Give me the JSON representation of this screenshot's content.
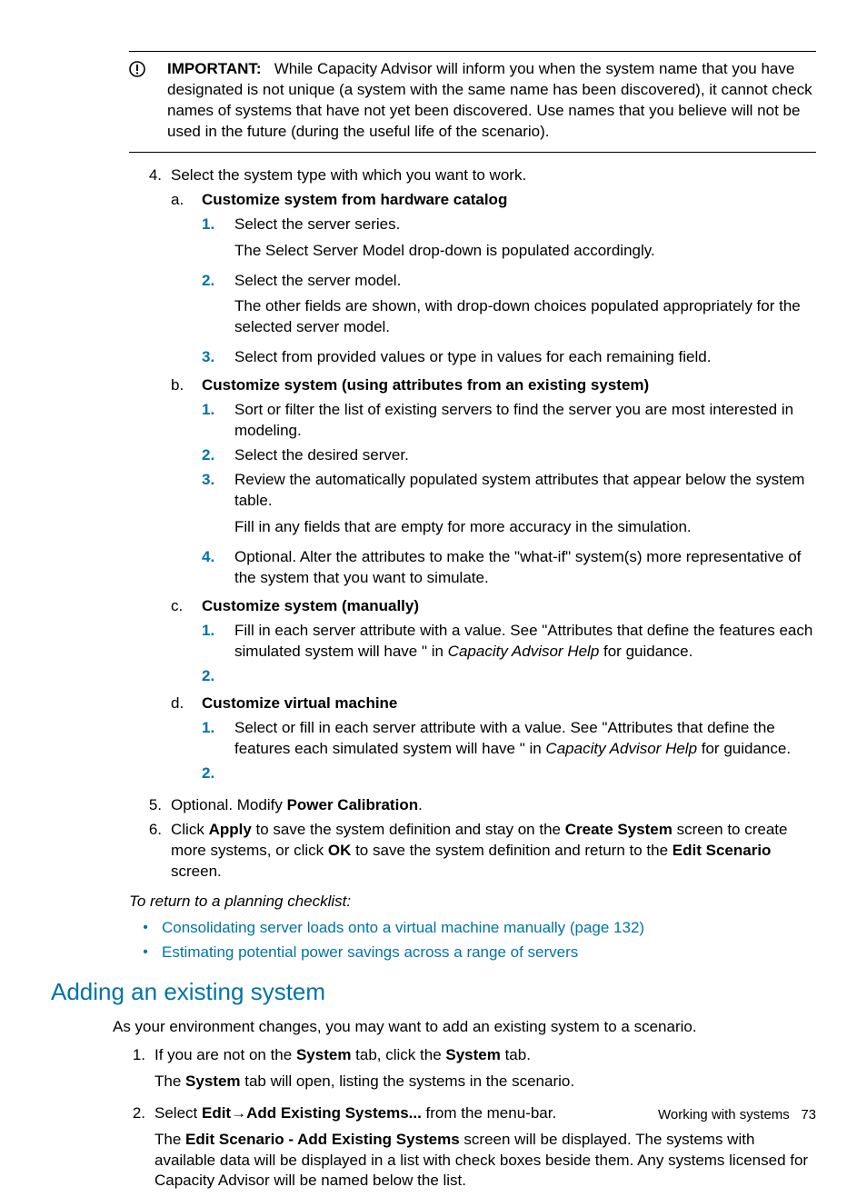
{
  "important": {
    "label": "IMPORTANT:",
    "text": "While Capacity Advisor will inform you when the system name that you have designated is not unique (a system with the same name has been discovered), it cannot check names of systems that have not yet been discovered. Use names that you believe will not be used in the future (during the useful life of the scenario)."
  },
  "step4": {
    "marker": "4.",
    "text": "Select the system type with which you want to work.",
    "a": {
      "marker": "a.",
      "title": "Customize system from hardware catalog",
      "s1": {
        "m": "1.",
        "t1": "Select the server series.",
        "t2": "The Select Server Model drop-down is populated accordingly."
      },
      "s2": {
        "m": "2.",
        "t1": "Select the server model.",
        "t2": "The other fields are shown, with drop-down choices populated appropriately for the selected server model."
      },
      "s3": {
        "m": "3.",
        "t1": "Select from provided values or type in values for each remaining field."
      }
    },
    "b": {
      "marker": "b.",
      "title": "Customize system (using attributes from an existing system)",
      "s1": {
        "m": "1.",
        "t1": "Sort or filter the list of existing servers to find the server you are most interested in modeling."
      },
      "s2": {
        "m": "2.",
        "t1": "Select the desired server."
      },
      "s3": {
        "m": "3.",
        "t1": "Review the automatically populated system attributes that appear below the system table.",
        "t2": "Fill in any fields that are empty for more accuracy in the simulation."
      },
      "s4": {
        "m": "4.",
        "t1": "Optional. Alter the attributes to make the \"what-if\" system(s) more representative of the system that you want to simulate."
      }
    },
    "c": {
      "marker": "c.",
      "title": "Customize system (manually)",
      "s1": {
        "m": "1.",
        "pre": "Fill in each server attribute with a value. See \"Attributes that define the features each simulated system will have \" in ",
        "cite": "Capacity Advisor Help",
        "post": " for guidance."
      },
      "s2": {
        "m": "2."
      }
    },
    "d": {
      "marker": "d.",
      "title": "Customize virtual machine",
      "s1": {
        "m": "1.",
        "pre": "Select or fill in each server attribute with a value. See \"Attributes that define the features each simulated system will have \" in ",
        "cite": "Capacity Advisor Help",
        "post": " for guidance."
      },
      "s2": {
        "m": "2."
      }
    }
  },
  "step5": {
    "marker": "5.",
    "pre": "Optional. Modify ",
    "b": "Power Calibration",
    "post": "."
  },
  "step6": {
    "marker": "6.",
    "p1": "Click ",
    "b1": "Apply",
    "p2": " to save the system definition and stay on the ",
    "b2": "Create System",
    "p3": " screen to create more systems, or click ",
    "b3": "OK",
    "p4": " to save the system definition and return to the ",
    "b4": "Edit Scenario",
    "p5": " screen."
  },
  "checklist": {
    "title": "To return to a planning checklist:",
    "l1": "Consolidating server loads onto a virtual machine manually (page 132)",
    "l2": "Estimating potential power savings across a range of servers"
  },
  "section": {
    "title": "Adding an existing system",
    "intro": "As your environment changes, you may want to add an existing system to a scenario.",
    "s1": {
      "m": "1.",
      "p1": "If you are not on the ",
      "b1": "System",
      "p2": " tab, click the ",
      "b2": "System",
      "p3": " tab.",
      "follow_pre": "The ",
      "follow_b": "System",
      "follow_post": " tab will open, listing the systems in the scenario."
    },
    "s2": {
      "m": "2.",
      "p1": "Select ",
      "b1": "Edit",
      "arrow": "→",
      "b2": "Add Existing Systems...",
      "p2": " from the menu-bar.",
      "follow_pre": "The ",
      "follow_b": "Edit Scenario - Add Existing Systems",
      "follow_post": " screen will be displayed. The systems with available data will be displayed in a list with check boxes beside them. Any systems licensed for Capacity Advisor will be named below the list."
    }
  },
  "footer": {
    "label": "Working with systems",
    "page": "73"
  }
}
